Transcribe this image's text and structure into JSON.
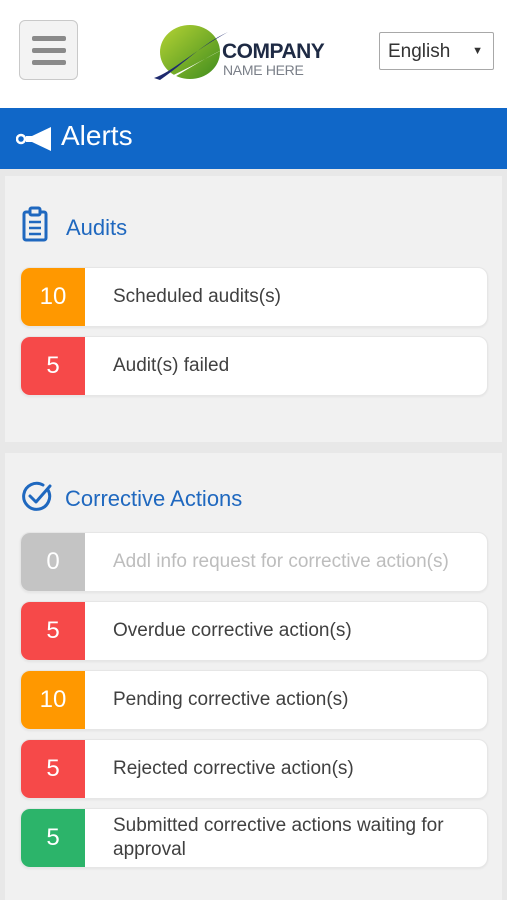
{
  "header": {
    "logo": {
      "line1": "COMPANY",
      "line2": "NAME HERE"
    },
    "language": {
      "selected": "English"
    }
  },
  "title_bar": {
    "title": "Alerts",
    "icon": "megaphone-icon"
  },
  "colors": {
    "primary": "#1067c8",
    "orange": "#ff9800",
    "red": "#f64949",
    "grey": "#c4c4c4",
    "green": "#2cb46a"
  },
  "audits": {
    "title": "Audits",
    "icon": "clipboard-icon",
    "items": [
      {
        "count": "10",
        "label": "Scheduled audits(s)",
        "color": "#ff9800"
      },
      {
        "count": "5",
        "label": "Audit(s) failed",
        "color": "#f64949"
      }
    ]
  },
  "corrective_actions": {
    "title": "Corrective Actions",
    "icon": "check-circle-icon",
    "items": [
      {
        "count": "0",
        "label": "Addl info request for corrective action(s)",
        "color": "#c4c4c4"
      },
      {
        "count": "5",
        "label": "Overdue corrective action(s)",
        "color": "#f64949"
      },
      {
        "count": "10",
        "label": "Pending corrective action(s)",
        "color": "#ff9800"
      },
      {
        "count": "5",
        "label": "Rejected corrective action(s)",
        "color": "#f64949"
      },
      {
        "count": "5",
        "label": "Submitted corrective actions waiting for approval",
        "color": "#2cb46a"
      }
    ]
  }
}
